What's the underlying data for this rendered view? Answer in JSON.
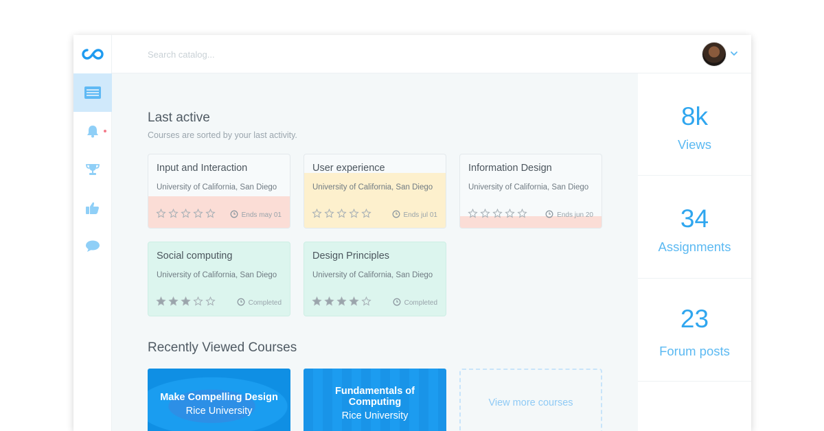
{
  "search": {
    "placeholder": "Search catalog..."
  },
  "sidebar": {
    "items": [
      {
        "icon": "catalog-icon",
        "active": true
      },
      {
        "icon": "bell-icon",
        "active": false,
        "notification": true
      },
      {
        "icon": "trophy-icon",
        "active": false
      },
      {
        "icon": "thumbs-up-icon",
        "active": false
      },
      {
        "icon": "chat-icon",
        "active": false
      }
    ]
  },
  "last_active": {
    "title": "Last active",
    "subtitle": "Courses are sorted by your last activity.",
    "courses": [
      {
        "title": "Input and Interaction",
        "university": "University of California, San Diego",
        "rating": 0,
        "status": "Ends may 01",
        "color": "#fbddd6"
      },
      {
        "title": "User experience",
        "university": "University of California, San Diego",
        "rating": 0,
        "status": "Ends jul 01",
        "color": "#fdf0cd"
      },
      {
        "title": "Information Design",
        "university": "University of California, San Diego",
        "rating": 0,
        "status": "Ends jun 20",
        "color": "#fbddd6"
      },
      {
        "title": "Social computing",
        "university": "University of California, San Diego",
        "rating": 3,
        "status": "Completed",
        "color": "#dcf5ee"
      },
      {
        "title": "Design Principles",
        "university": "University of California, San Diego",
        "rating": 4,
        "status": "Completed",
        "color": "#dcf5ee"
      }
    ]
  },
  "recently_viewed": {
    "title": "Recently Viewed Courses",
    "courses": [
      {
        "title": "Make Compelling Design",
        "university": "Rice University"
      },
      {
        "title": "Fundamentals of Computing",
        "university": "Rice University"
      }
    ],
    "view_more": "View more courses"
  },
  "stats": [
    {
      "value": "8k",
      "label": "Views"
    },
    {
      "value": "34",
      "label": "Assignments"
    },
    {
      "value": "23",
      "label": "Forum posts"
    }
  ],
  "colors": {
    "accent": "#2fa6ef",
    "tile_blue": "#1a9df0"
  }
}
